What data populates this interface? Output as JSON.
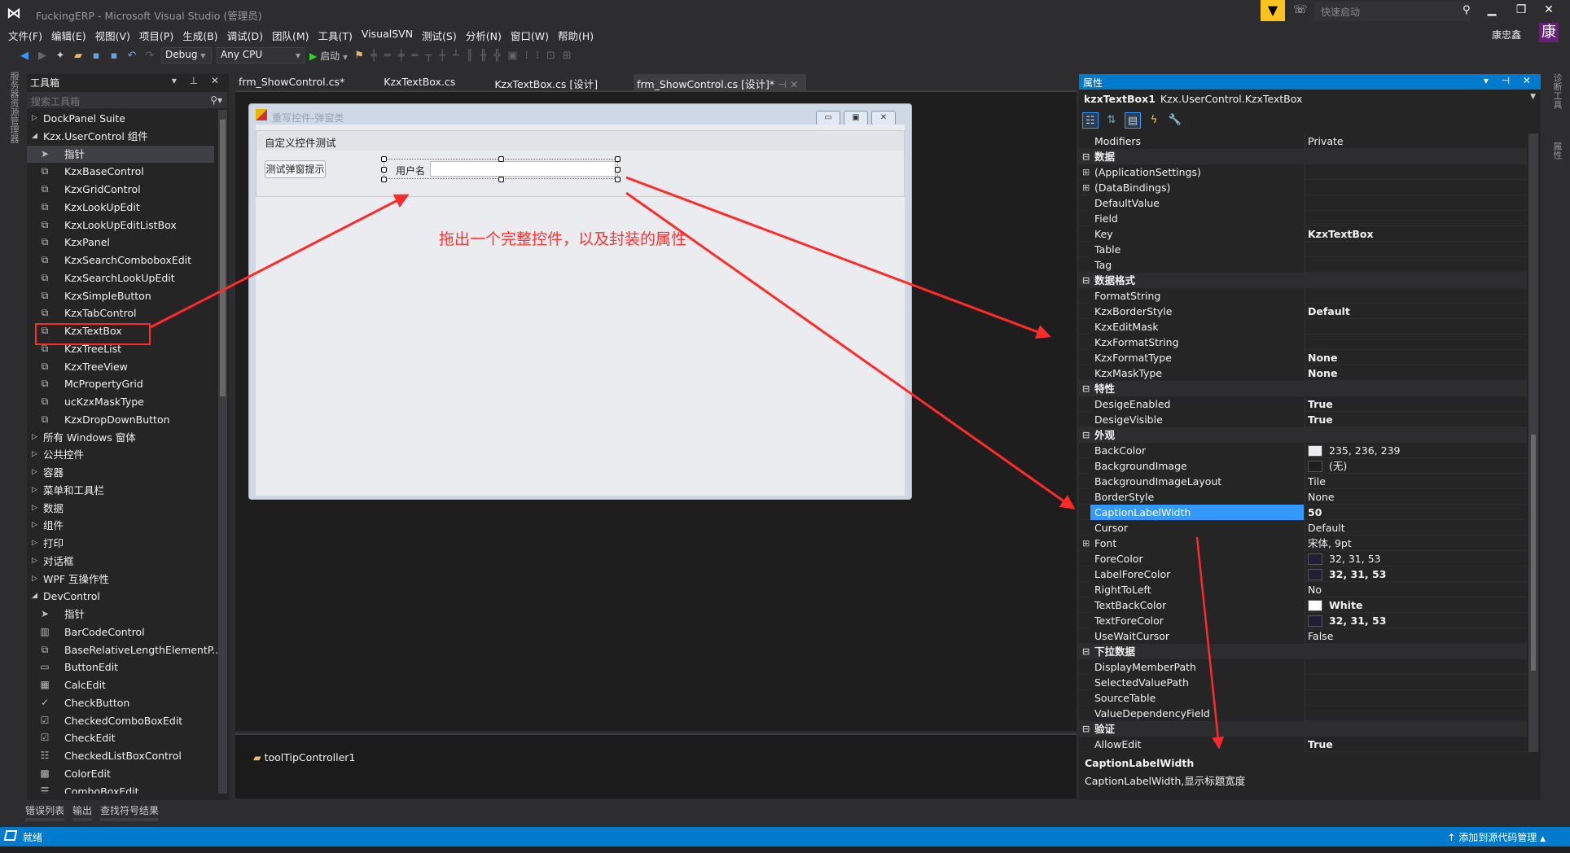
{
  "window": {
    "title": "FuckingERP - Microsoft Visual Studio (管理员)",
    "quick_launch_placeholder": "快速启动",
    "user": "康忠鑫",
    "user_initial": "康"
  },
  "menu": [
    "文件(F)",
    "编辑(E)",
    "视图(V)",
    "项目(P)",
    "生成(B)",
    "调试(D)",
    "团队(M)",
    "工具(T)",
    "VisualSVN",
    "测试(S)",
    "分析(N)",
    "窗口(W)",
    "帮助(H)"
  ],
  "toolbar": {
    "config": "Debug",
    "platform": "Any CPU",
    "start": "启动"
  },
  "left_strip": {
    "label": "服务器资源管理器"
  },
  "toolbox": {
    "title": "工具箱",
    "search_placeholder": "搜索工具箱",
    "items": [
      {
        "type": "cat",
        "label": "DockPanel Suite",
        "expanded": false
      },
      {
        "type": "cat",
        "label": "Kzx.UserControl 组件",
        "expanded": true
      },
      {
        "type": "item",
        "label": "指针",
        "icon": "pointer",
        "selected": true
      },
      {
        "type": "item",
        "label": "KzxBaseControl",
        "icon": "usercontrol"
      },
      {
        "type": "item",
        "label": "KzxGridControl",
        "icon": "usercontrol"
      },
      {
        "type": "item",
        "label": "KzxLookUpEdit",
        "icon": "usercontrol"
      },
      {
        "type": "item",
        "label": "KzxLookUpEditListBox",
        "icon": "usercontrol"
      },
      {
        "type": "item",
        "label": "KzxPanel",
        "icon": "usercontrol"
      },
      {
        "type": "item",
        "label": "KzxSearchComboboxEdit",
        "icon": "usercontrol"
      },
      {
        "type": "item",
        "label": "KzxSearchLookUpEdit",
        "icon": "usercontrol"
      },
      {
        "type": "item",
        "label": "KzxSimpleButton",
        "icon": "usercontrol"
      },
      {
        "type": "item",
        "label": "KzxTabControl",
        "icon": "usercontrol"
      },
      {
        "type": "item",
        "label": "KzxTextBox",
        "icon": "usercontrol"
      },
      {
        "type": "item",
        "label": "KzxTreeList",
        "icon": "usercontrol"
      },
      {
        "type": "item",
        "label": "KzxTreeView",
        "icon": "usercontrol"
      },
      {
        "type": "item",
        "label": "McPropertyGrid",
        "icon": "usercontrol"
      },
      {
        "type": "item",
        "label": "ucKzxMaskType",
        "icon": "usercontrol"
      },
      {
        "type": "item",
        "label": "KzxDropDownButton",
        "icon": "usercontrol"
      },
      {
        "type": "cat",
        "label": "所有 Windows 窗体",
        "expanded": false
      },
      {
        "type": "cat",
        "label": "公共控件",
        "expanded": false
      },
      {
        "type": "cat",
        "label": "容器",
        "expanded": false
      },
      {
        "type": "cat",
        "label": "菜单和工具栏",
        "expanded": false
      },
      {
        "type": "cat",
        "label": "数据",
        "expanded": false
      },
      {
        "type": "cat",
        "label": "组件",
        "expanded": false
      },
      {
        "type": "cat",
        "label": "打印",
        "expanded": false
      },
      {
        "type": "cat",
        "label": "对话框",
        "expanded": false
      },
      {
        "type": "cat",
        "label": "WPF 互操作性",
        "expanded": false
      },
      {
        "type": "cat",
        "label": "DevControl",
        "expanded": true
      },
      {
        "type": "item",
        "label": "指针",
        "icon": "pointer"
      },
      {
        "type": "item",
        "label": "BarCodeControl",
        "icon": "barcode"
      },
      {
        "type": "item",
        "label": "BaseRelativeLengthElementP...",
        "icon": "usercontrol"
      },
      {
        "type": "item",
        "label": "ButtonEdit",
        "icon": "buttonedit"
      },
      {
        "type": "item",
        "label": "CalcEdit",
        "icon": "calculator"
      },
      {
        "type": "item",
        "label": "CheckButton",
        "icon": "checkbutton"
      },
      {
        "type": "item",
        "label": "CheckedComboBoxEdit",
        "icon": "checkedcombo"
      },
      {
        "type": "item",
        "label": "CheckEdit",
        "icon": "checkbox"
      },
      {
        "type": "item",
        "label": "CheckedListBoxControl",
        "icon": "checkedlist"
      },
      {
        "type": "item",
        "label": "ColorEdit",
        "icon": "palette"
      },
      {
        "type": "item",
        "label": "ComboBoxEdit",
        "icon": "combobox"
      }
    ]
  },
  "bottom_tabs": [
    "错误列表",
    "输出",
    "查找符号结果"
  ],
  "doc_tabs": [
    {
      "label": "frm_ShowControl.cs*",
      "active": false
    },
    {
      "label": "KzxTextBox.cs",
      "active": false
    },
    {
      "label": "KzxTextBox.cs [设计]",
      "active": false
    },
    {
      "label": "frm_ShowControl.cs [设计]*",
      "active": true
    }
  ],
  "form": {
    "title": "重写控件-弹窗类",
    "group_title": "自定义控件测试",
    "button_label": "测试弹窗提示",
    "textbox_caption": "用户名",
    "textbox_value": ""
  },
  "tray": {
    "component": "toolTipController1"
  },
  "annotation": {
    "text": "拖出一个完整控件，以及封装的属性",
    "color": "#ff2a2a"
  },
  "properties": {
    "title": "属性",
    "object_name": "kzxTextBox1",
    "object_type": "Kzx.UserControl.KzxTextBox",
    "rows": [
      {
        "name": "Modifiers",
        "value": "Private"
      },
      {
        "cat": true,
        "name": "数据"
      },
      {
        "name": "(ApplicationSettings)",
        "expand": true,
        "value": ""
      },
      {
        "name": "(DataBindings)",
        "expand": true,
        "value": ""
      },
      {
        "name": "DefaultValue",
        "value": ""
      },
      {
        "name": "Field",
        "value": ""
      },
      {
        "name": "Key",
        "value": "KzxTextBox",
        "bold": true
      },
      {
        "name": "Table",
        "value": ""
      },
      {
        "name": "Tag",
        "value": ""
      },
      {
        "cat": true,
        "name": "数据格式"
      },
      {
        "name": "FormatString",
        "value": ""
      },
      {
        "name": "KzxBorderStyle",
        "value": "Default",
        "bold": true
      },
      {
        "name": "KzxEditMask",
        "value": ""
      },
      {
        "name": "KzxFormatString",
        "value": ""
      },
      {
        "name": "KzxFormatType",
        "value": "None",
        "bold": true
      },
      {
        "name": "KzxMaskType",
        "value": "None",
        "bold": true
      },
      {
        "cat": true,
        "name": "特性"
      },
      {
        "name": "DesigeEnabled",
        "value": "True",
        "bold": true
      },
      {
        "name": "DesigeVisible",
        "value": "True",
        "bold": true
      },
      {
        "cat": true,
        "name": "外观"
      },
      {
        "name": "BackColor",
        "value": "235, 236, 239",
        "swatch": "#ebecef"
      },
      {
        "name": "BackgroundImage",
        "value": "(无)",
        "swatch": "#1e1e1e"
      },
      {
        "name": "BackgroundImageLayout",
        "value": "Tile"
      },
      {
        "name": "BorderStyle",
        "value": "None"
      },
      {
        "name": "CaptionLabelWidth",
        "value": "50",
        "bold": true,
        "selected": true
      },
      {
        "name": "Cursor",
        "value": "Default"
      },
      {
        "name": "Font",
        "expand": true,
        "value": "宋体, 9pt"
      },
      {
        "name": "ForeColor",
        "value": "32, 31, 53",
        "swatch": "#201f35"
      },
      {
        "name": "LabelForeColor",
        "value": "32, 31, 53",
        "swatch": "#201f35",
        "bold": true
      },
      {
        "name": "RightToLeft",
        "value": "No"
      },
      {
        "name": "TextBackColor",
        "value": "White",
        "swatch": "#ffffff",
        "bold": true
      },
      {
        "name": "TextForeColor",
        "value": "32, 31, 53",
        "swatch": "#201f35",
        "bold": true
      },
      {
        "name": "UseWaitCursor",
        "value": "False"
      },
      {
        "cat": true,
        "name": "下拉数据"
      },
      {
        "name": "DisplayMemberPath",
        "value": ""
      },
      {
        "name": "SelectedValuePath",
        "value": ""
      },
      {
        "name": "SourceTable",
        "value": ""
      },
      {
        "name": "ValueDependencyField",
        "value": ""
      },
      {
        "cat": true,
        "name": "验证"
      },
      {
        "name": "AllowEdit",
        "value": "True",
        "bold": true
      }
    ],
    "description_title": "CaptionLabelWidth",
    "description_text": "CaptionLabelWidth,显示标题宽度"
  },
  "right_strip": [
    "诊断工具",
    "属性"
  ],
  "status": {
    "text": "就绪",
    "right": "添加到源代码管理"
  },
  "colors": {
    "accent": "#007acc",
    "selection": "#3399ff",
    "filter": "#fbc31e",
    "avatar": "#68217a"
  }
}
